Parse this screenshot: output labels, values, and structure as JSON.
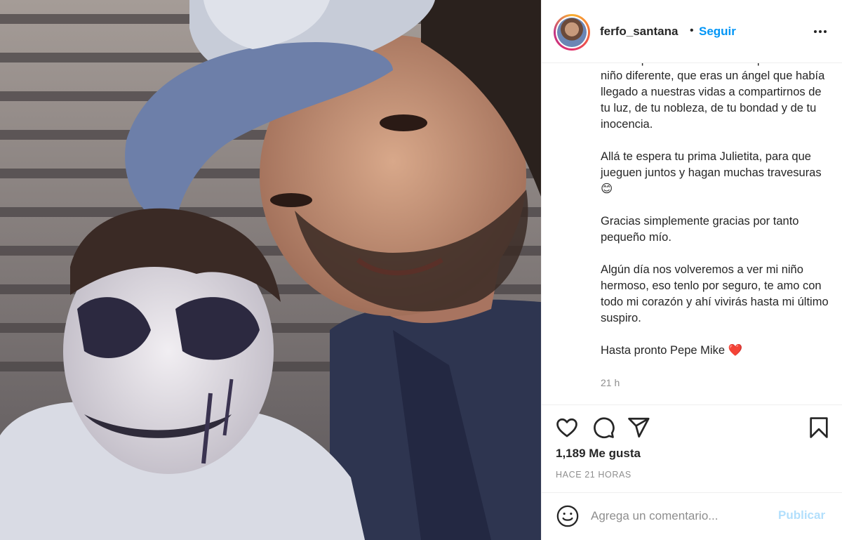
{
  "post": {
    "username": "ferfo_santana",
    "separator": "•",
    "follow_label": "Seguir",
    "more_icon": "more-options-icon"
  },
  "caption": {
    "paragraphs": [
      "Desde que naciste sabíamos que eras un niño diferente, que eras un ángel que había llegado a nuestras vidas a compartirnos de tu luz, de tu nobleza, de tu bondad y de tu inocencia.",
      "Allá te espera tu prima Julietita, para que jueguen juntos y hagan muchas travesuras 😊",
      "Gracias simplemente gracias por tanto pequeño mío.",
      "Algún día nos volveremos a ver mi niño hermoso, eso tenlo por seguro, te amo con todo mi corazón y ahí vivirás hasta mi último suspiro.",
      "Hasta pronto Pepe Mike ❤️"
    ],
    "relative_time": "21 h"
  },
  "actions": {
    "icons": [
      "heart-icon",
      "comment-icon",
      "share-icon",
      "bookmark-icon"
    ]
  },
  "likes": "1,189 Me gusta",
  "post_time": "HACE 21 HORAS",
  "comment": {
    "placeholder": "Agrega un comentario...",
    "value": "",
    "publish_label": "Publicar",
    "emoji_icon": "emoji-icon"
  },
  "colors": {
    "accent": "#0095f6",
    "publish_disabled": "#b2dffc",
    "text": "#262626",
    "muted": "#8e8e8e",
    "border": "#efefef"
  }
}
